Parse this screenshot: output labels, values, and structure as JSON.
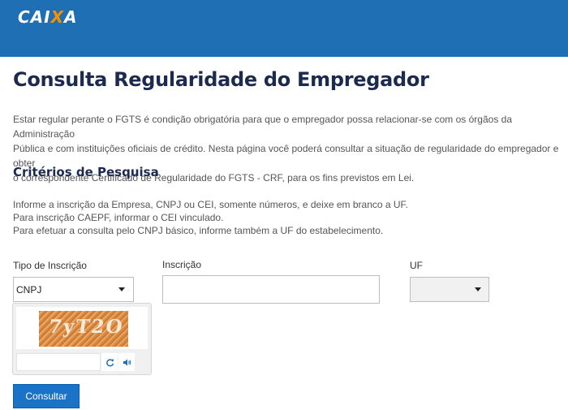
{
  "header": {
    "logo": {
      "text_main": "CAI",
      "text_accent": "X",
      "text_end": "A"
    }
  },
  "page": {
    "title": "Consulta Regularidade do Empregador",
    "intro_lines": [
      "Estar regular perante o FGTS é condição obrigatória para que o empregador possa relacionar-se com os órgãos da Administração",
      "Pública e com instituições oficiais de crédito. Nesta página você poderá consultar a situação de regularidade do empregador e obter",
      "o correspondente Certificado de Regularidade do FGTS - CRF, para os fins previstos em Lei."
    ]
  },
  "search": {
    "section_title": "Critérios de Pesquisa",
    "instructions": [
      "Informe a inscrição da Empresa, CNPJ ou CEI, somente números, e deixe em branco a UF.",
      "Para inscrição CAEPF, informar o CEI vinculado.",
      "Para efetuar a consulta pelo CNPJ básico, informe também a UF do estabelecimento."
    ],
    "tipo_label": "Tipo de Inscrição",
    "tipo_value": "CNPJ",
    "inscricao_label": "Inscrição",
    "inscricao_value": "",
    "uf_label": "UF",
    "uf_value": ""
  },
  "captcha": {
    "image_text": "7yT2O",
    "input_value": "",
    "refresh_icon": "refresh-icon",
    "audio_icon": "speaker-icon",
    "accent_color": "#1f6fb4"
  },
  "actions": {
    "submit_label": "Consultar"
  },
  "colors": {
    "header_bg": "#1f6fb4",
    "logo_accent": "#f39200",
    "title": "#1b2a4e",
    "button": "#1a73c7"
  }
}
